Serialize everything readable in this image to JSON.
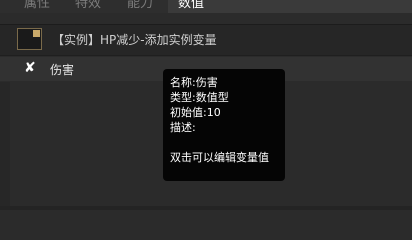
{
  "tabs": [
    {
      "label": "属性"
    },
    {
      "label": "特效"
    },
    {
      "label": "能力"
    },
    {
      "label": "数值"
    }
  ],
  "header": {
    "icon": "instance-image-icon",
    "title": "【实例】HP减少-添加实例变量"
  },
  "variable": {
    "icon": "variable-x-icon",
    "label": "伤害"
  },
  "tooltip": {
    "name_line": "名称:伤害",
    "type_line": "类型:数值型",
    "initial_line": "初始值:10",
    "desc_line": "描述:",
    "hint": "双击可以编辑变量值"
  },
  "colors": {
    "background": "#2b2b2b",
    "tooltip_bg": "#050505",
    "icon_accent": "#c9a96a"
  }
}
